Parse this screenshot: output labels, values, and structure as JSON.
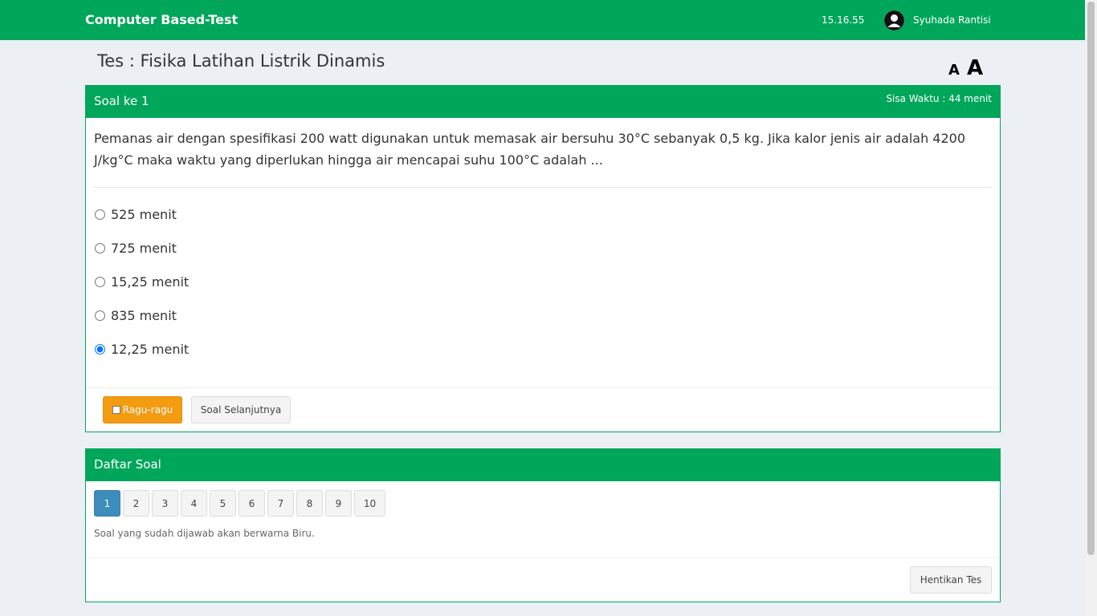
{
  "header": {
    "brand": "Computer Based-Test",
    "clock": "15.16.55",
    "username": "Syuhada Rantisi",
    "avatar_icon": "user-icon"
  },
  "page": {
    "title": "Tes : Fisika Latihan Listrik Dinamis",
    "font_small_label": "A",
    "font_large_label": "A"
  },
  "question_box": {
    "title": "Soal ke 1",
    "time_left": "Sisa Waktu : 44 menit",
    "question": "Pemanas air dengan spesifikasi 200 watt digunakan untuk memasak air bersuhu 30°C sebanyak 0,5 kg. Jika kalor jenis air adalah 4200 J/kg°C maka waktu yang diperlukan hingga air mencapai suhu 100°C adalah ...",
    "options": [
      {
        "label": "525 menit",
        "selected": false
      },
      {
        "label": "725 menit",
        "selected": false
      },
      {
        "label": "15,25 menit",
        "selected": false
      },
      {
        "label": "835 menit",
        "selected": false
      },
      {
        "label": "12,25 menit",
        "selected": true
      }
    ],
    "doubt_label": "Ragu-ragu",
    "next_label": "Soal Selanjutnya"
  },
  "question_list": {
    "title": "Daftar Soal",
    "numbers": [
      "1",
      "2",
      "3",
      "4",
      "5",
      "6",
      "7",
      "8",
      "9",
      "10"
    ],
    "active": "1",
    "hint": "Soal yang sudah dijawab akan berwarna Biru.",
    "stop_label": "Hentikan Tes"
  },
  "colors": {
    "primary": "#00a65a",
    "answered": "#3c8dbc",
    "warning": "#f39c12",
    "background": "#ecf0f5"
  }
}
